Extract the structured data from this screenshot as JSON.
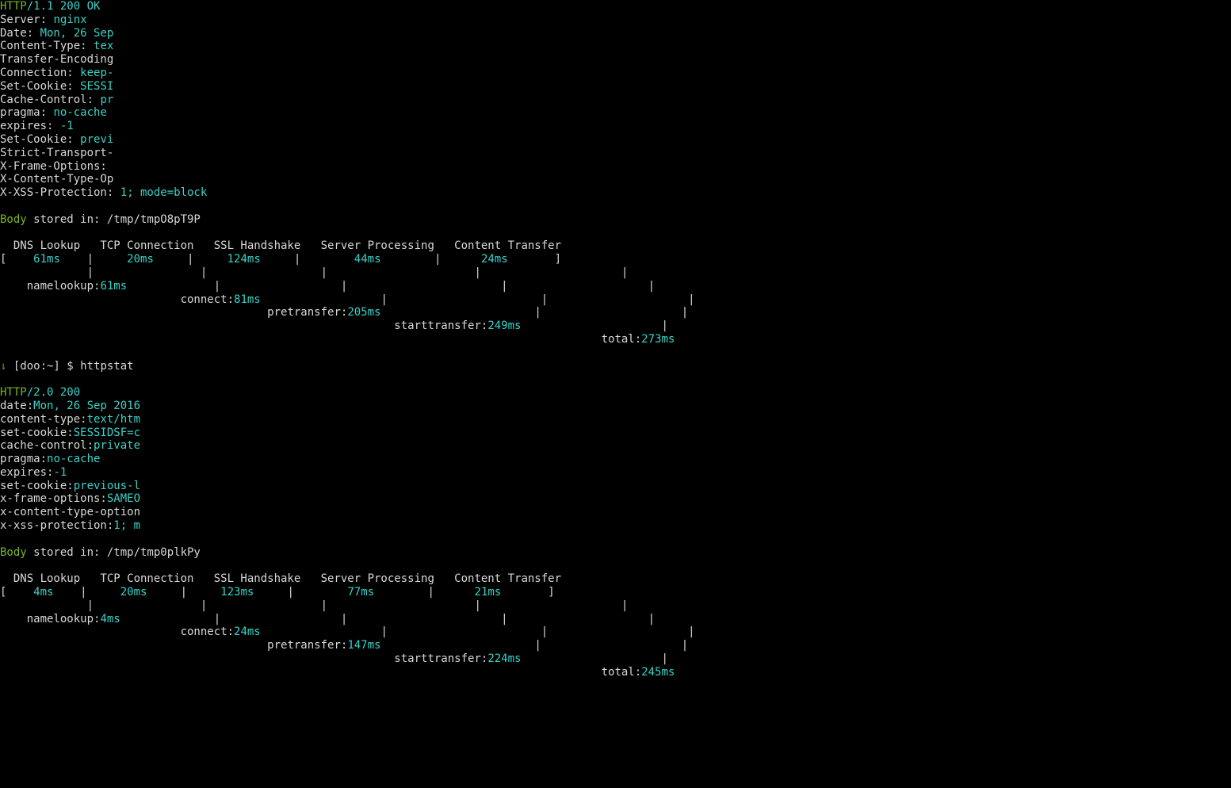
{
  "req1": {
    "status_proto": "HTTP",
    "status_rest": "/1.1 200 OK",
    "headers": [
      {
        "k": "Server: ",
        "v": "nginx",
        "mask": null
      },
      {
        "k": "Date: ",
        "v": "Mon, 26 Sep",
        "mask": "                         "
      },
      {
        "k": "Content-Type: ",
        "v": "tex",
        "mask": "           "
      },
      {
        "k": "Transfer-Encoding",
        "v": "",
        "mask": "        "
      },
      {
        "k": "Connection: ",
        "v": "keep-",
        "mask": "     "
      },
      {
        "k": "Set-Cookie: ",
        "v": "SESSI",
        "mask": "                                                                  "
      },
      {
        "k": "Cache-Control: ",
        "v": "pr",
        "mask": "                          "
      },
      {
        "k": "pragma: ",
        "v": "no-cache",
        "mask": null
      },
      {
        "k": "expires: ",
        "v": "-1",
        "mask": null
      },
      {
        "k": "Set-Cookie: ",
        "v": "previ",
        "mask": "                                                                                                                           "
      },
      {
        "k": "Strict-Transport-",
        "v": "",
        "mask": "                                                 "
      },
      {
        "k": "X-Frame-Options:",
        "v": "",
        "mask": "        "
      },
      {
        "k": "X-Content-Type-Op",
        "v": "",
        "mask": "            "
      },
      {
        "k": "X-XSS-Protection: ",
        "v": "1; mode=block",
        "mask": null
      }
    ],
    "body_label": "Body",
    "body_rest": " stored in: /tmp/tmpO8pT9P",
    "stage_labels": "  DNS Lookup   TCP Connection   SSL Handshake   Server Processing   Content Transfer",
    "stages": {
      "dns": "61ms",
      "tcp": "20ms",
      "ssl": "124ms",
      "srv": "44ms",
      "ct": "24ms"
    },
    "rows": [
      {
        "label": "namelookup:",
        "value": "61ms",
        "pad": "    ",
        "trail": "             |                  |                       |                     |"
      },
      {
        "label": "connect:",
        "value": "81ms",
        "pad": "                           ",
        "trail": "                  |                       |                     |"
      },
      {
        "label": "pretransfer:",
        "value": "205ms",
        "pad": "                                        ",
        "trail": "                       |                     |"
      },
      {
        "label": "starttransfer:",
        "value": "249ms",
        "pad": "                                                           ",
        "trail": "                     |"
      },
      {
        "label": "total:",
        "value": "273ms",
        "pad": "                                                                                          ",
        "trail": ""
      }
    ]
  },
  "prompt": {
    "arrow": "⇂ ",
    "host": "[doo:~] $ ",
    "cmd": "httpstat ",
    "arg_mask": "                             "
  },
  "req2": {
    "status_proto": "HTTP",
    "status_rest": "/2.0 200",
    "headers": [
      {
        "k": "date:",
        "v": "Mon, 26 Sep 2016",
        "mask": "               "
      },
      {
        "k": "content-type:",
        "v": "text/htm",
        "mask": "                "
      },
      {
        "k": "set-cookie:",
        "v": "SESSIDSF=c",
        "mask": "                                                                   "
      },
      {
        "k": "cache-control:",
        "v": "private",
        "mask": "                "
      },
      {
        "k": "pragma:",
        "v": "no-cache",
        "mask": null
      },
      {
        "k": "expires:",
        "v": "-1",
        "mask": null
      },
      {
        "k": "set-cookie:",
        "v": "previous-l",
        "mask": "                                                                                                                          "
      },
      {
        "k": "x-frame-options:",
        "v": "SAMEO",
        "mask": "       "
      },
      {
        "k": "x-content-type-option",
        "v": "",
        "mask": "         "
      },
      {
        "k": "x-xss-protection:",
        "v": "1; m",
        "mask": "           "
      }
    ],
    "body_label": "Body",
    "body_rest": " stored in: /tmp/tmp0plkPy",
    "stage_labels": "  DNS Lookup   TCP Connection   SSL Handshake   Server Processing   Content Transfer",
    "stages": {
      "dns": "4ms",
      "tcp": "20ms",
      "ssl": "123ms",
      "srv": "77ms",
      "ct": "21ms"
    },
    "rows": [
      {
        "label": "namelookup:",
        "value": "4ms",
        "pad": "    ",
        "trail": "              |                  |                       |                     |"
      },
      {
        "label": "connect:",
        "value": "24ms",
        "pad": "                           ",
        "trail": "                  |                       |                     |"
      },
      {
        "label": "pretransfer:",
        "value": "147ms",
        "pad": "                                        ",
        "trail": "                       |                     |"
      },
      {
        "label": "starttransfer:",
        "value": "224ms",
        "pad": "                                                           ",
        "trail": "                     |"
      },
      {
        "label": "total:",
        "value": "245ms",
        "pad": "                                                                                          ",
        "trail": ""
      }
    ]
  }
}
